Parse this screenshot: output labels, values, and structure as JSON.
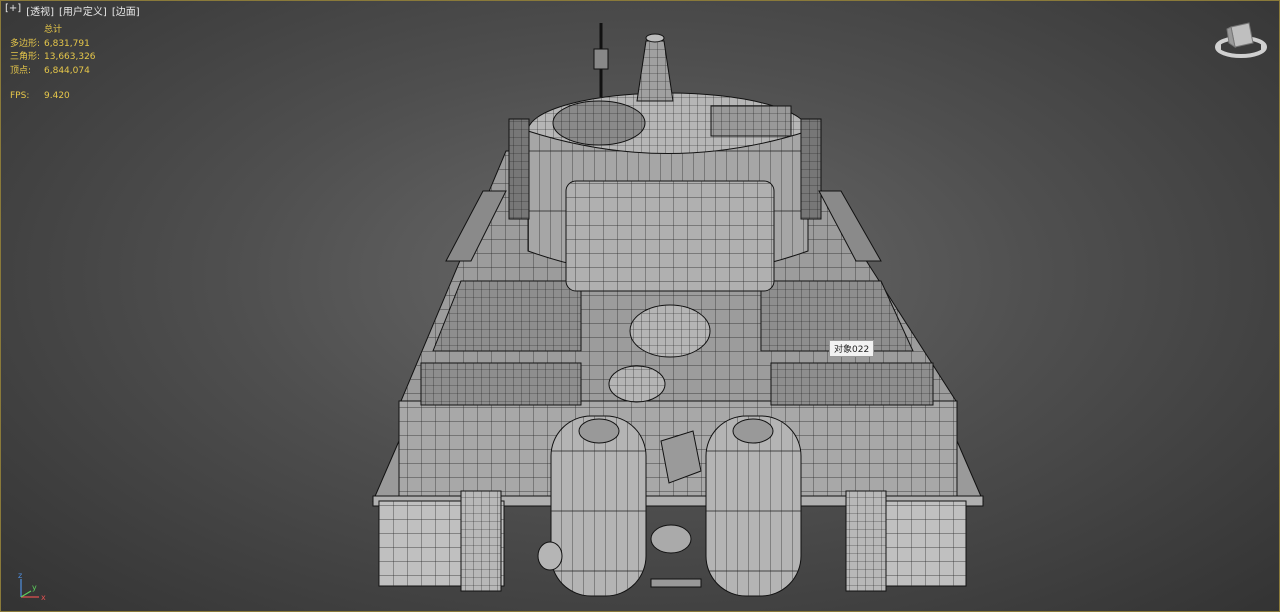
{
  "viewport": {
    "labels": [
      "[+]",
      "[透视]",
      "[用户定义]",
      "[边面]"
    ],
    "stats": {
      "header": "总计",
      "polys_label": "多边形:",
      "polys_value": "6,831,791",
      "tris_label": "三角形:",
      "tris_value": "13,663,326",
      "verts_label": "顶点:",
      "verts_value": "6,844,074"
    },
    "fps_label": "FPS:",
    "fps_value": "9.420",
    "object_tag": "对象022",
    "axis_labels": {
      "x": "x",
      "y": "y",
      "z": "z"
    }
  },
  "colors": {
    "stats_text": "#e6c74a",
    "border": "#8a7a3a",
    "mesh_fill": "#a9a9a9",
    "wire": "#1a1a1a"
  },
  "icons": [
    "viewcube-icon",
    "axis-tripod-icon"
  ]
}
